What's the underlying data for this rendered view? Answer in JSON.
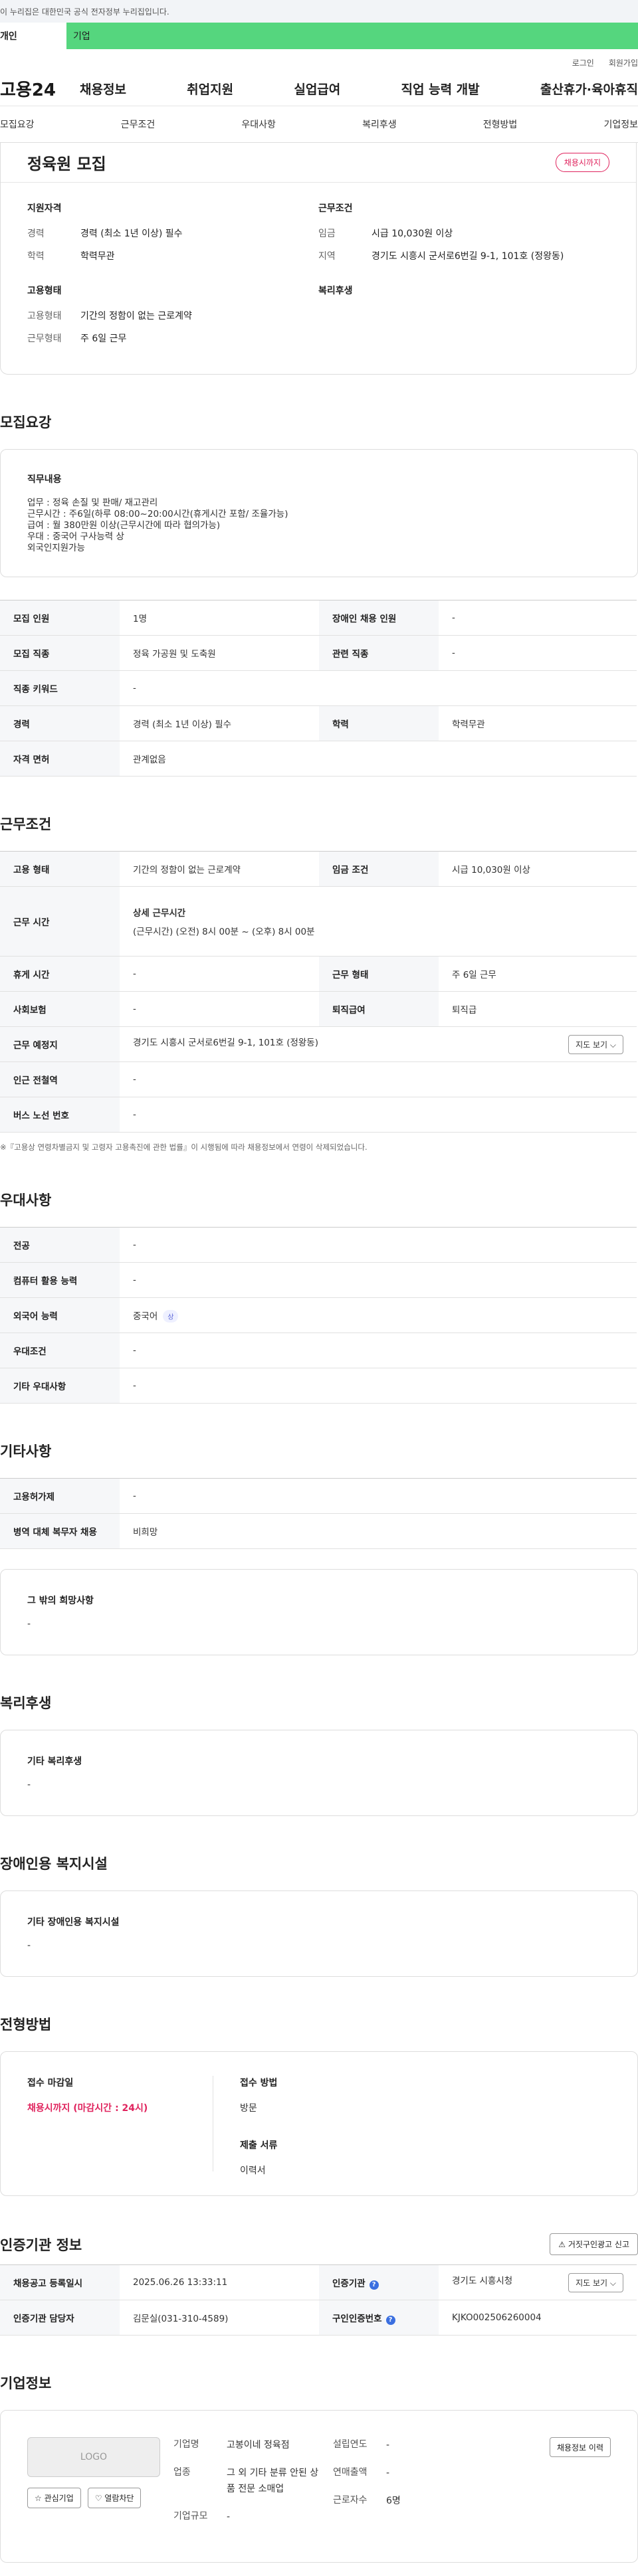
{
  "banner": {
    "text": "이 누리집은 대한민국 공식 전자정부 누리집입니다."
  },
  "user_tabs": [
    "개인",
    "기업"
  ],
  "top_links": [
    "로그인",
    "회원가입"
  ],
  "gnb": {
    "logo": "고용24",
    "menu": [
      "채용정보",
      "취업지원",
      "실업급여",
      "직업 능력 개발",
      "출산휴가·육아휴직"
    ]
  },
  "sub_tabs": [
    "모집요강",
    "근무조건",
    "우대사항",
    "복리후생",
    "전형방법",
    "기업정보"
  ],
  "summary": {
    "title": "정육원 모집",
    "deadline_badge": "채용시까지",
    "qualification": {
      "title": "지원자격",
      "rows": [
        {
          "k": "경력",
          "v": "경력 (최소 1년 이상) 필수"
        },
        {
          "k": "학력",
          "v": "학력무관"
        }
      ]
    },
    "employment": {
      "title": "고용형태",
      "rows": [
        {
          "k": "고용형태",
          "v": "기간의 정함이 없는 근로계약"
        },
        {
          "k": "근무형태",
          "v": "주 6일 근무"
        }
      ]
    },
    "conditions": {
      "title": "근무조건",
      "rows": [
        {
          "k": "임금",
          "v": "시급 10,030원 이상"
        },
        {
          "k": "지역",
          "v": "경기도 시흥시 군서로6번길 9-1, 101호 (정왕동)"
        }
      ]
    },
    "welfare_title": "복리후생"
  },
  "recruit": {
    "section_title": "모집요강",
    "duty_title": "직무내용",
    "duty_lines": [
      "업무 : 정육 손질 및 판매/ 재고관리",
      "근무시간 : 주6일(하루 08:00~20:00시간(휴게시간 포함/ 조율가능)",
      "급여 : 월 380만원 이상(근무시간에 따라 협의가능)",
      "우대 : 중국어 구사능력 상",
      "외국인지원가능"
    ],
    "rows": [
      {
        "k1": "모집 인원",
        "v1": "1명",
        "k2": "장애인 채용 인원",
        "v2": "-"
      },
      {
        "k1": "모집 직종",
        "v1": "정육 가공원 및 도축원",
        "k2": "관련 직종",
        "v2": "-"
      },
      {
        "k1": "직종 키워드",
        "v1": "-"
      },
      {
        "k1": "경력",
        "v1": "경력 (최소 1년 이상) 필수",
        "k2": "학력",
        "v2": "학력무관"
      },
      {
        "k1": "자격 면허",
        "v1": "관계없음"
      }
    ]
  },
  "work": {
    "section_title": "근무조건",
    "type_k": "고용 형태",
    "type_v": "기간의 정함이 없는 근로계약",
    "wage_k": "임금 조건",
    "wage_v": "시급 10,030원 이상",
    "hours_k": "근무 시간",
    "hours_title": "상세 근무시간",
    "hours_v": "(근무시간) (오전) 8시 00분 ~ (오후) 8시 00분",
    "break_k": "휴게 시간",
    "break_v": "-",
    "form_k": "근무 형태",
    "form_v": "주 6일 근무",
    "insurance_k": "사회보험",
    "insurance_v": "-",
    "severance_k": "퇴직급여",
    "severance_v": "퇴직급",
    "place_k": "근무 예정지",
    "place_v": "경기도 시흥시 군서로6번길 9-1, 101호 (정왕동)",
    "map_btn": "지도 보기 ⌵",
    "station_k": "인근 전철역",
    "station_v": "-",
    "bus_k": "버스 노선 번호",
    "bus_v": "-",
    "note": "※『고용상 연령차별금지 및 고령자 고용촉진에 관한 법률』이 시행됨에 따라 채용정보에서 연령이 삭제되었습니다."
  },
  "preferred": {
    "section_title": "우대사항",
    "rows": [
      {
        "k": "전공",
        "v": "-"
      },
      {
        "k": "컴퓨터 활용 능력",
        "v": "-"
      },
      {
        "k": "외국어 능력",
        "v": "중국어",
        "tag": "상"
      },
      {
        "k": "우대조건",
        "v": "-"
      },
      {
        "k": "기타 우대사항",
        "v": "-"
      }
    ]
  },
  "etc": {
    "section_title": "기타사항",
    "rows": [
      {
        "k": "고용허가제",
        "v": "-"
      },
      {
        "k": "병역 대체 복무자 채용",
        "v": "비희망"
      }
    ],
    "other_title": "그 밖의 희망사항",
    "other_v": "-"
  },
  "welfare": {
    "section_title": "복리후생",
    "sub_title": "기타 복리후생",
    "v": "-"
  },
  "disabled": {
    "section_title": "장애인용 복지시설",
    "sub_title": "기타 장애인용 복지시설",
    "v": "-"
  },
  "process": {
    "section_title": "전형방법",
    "deadline_title": "접수 마감일",
    "deadline_v": "채용시까지 (마감시간 : 24시)",
    "method_title": "접수 방법",
    "method_v": "방문",
    "docs_title": "제출 서류",
    "docs_v": "이력서"
  },
  "cert": {
    "section_title": "인증기관 정보",
    "report_btn": "⚠ 거짓구인광고 신고",
    "rows": [
      {
        "k1": "채용공고 등록일시",
        "v1": "2025.06.26 13:33:11",
        "k2": "인증기관",
        "v2": "경기도 시흥시청",
        "btn": "지도 보기 ⌵"
      },
      {
        "k1": "인증기관 담당자",
        "v1": "김문실(031-310-4589)",
        "k2": "구인인증번호",
        "v2": "KJKO002506260004"
      }
    ]
  },
  "company": {
    "section_title": "기업정보",
    "logo": "LOGO",
    "fav_btn": "☆ 관심기업",
    "block_btn": "♡ 열람차단",
    "history_btn": "채용정보 이력",
    "col1": [
      {
        "k": "기업명",
        "v": "고봉이네 정육점"
      },
      {
        "k": "업종",
        "v": "그 외 기타 분류 안된 상품 전문 소매업"
      },
      {
        "k": "기업규모",
        "v": "-"
      }
    ],
    "col2": [
      {
        "k": "설립연도",
        "v": "-"
      },
      {
        "k": "연매출액",
        "v": "-"
      },
      {
        "k": "근로자수",
        "v": "6명"
      }
    ]
  }
}
